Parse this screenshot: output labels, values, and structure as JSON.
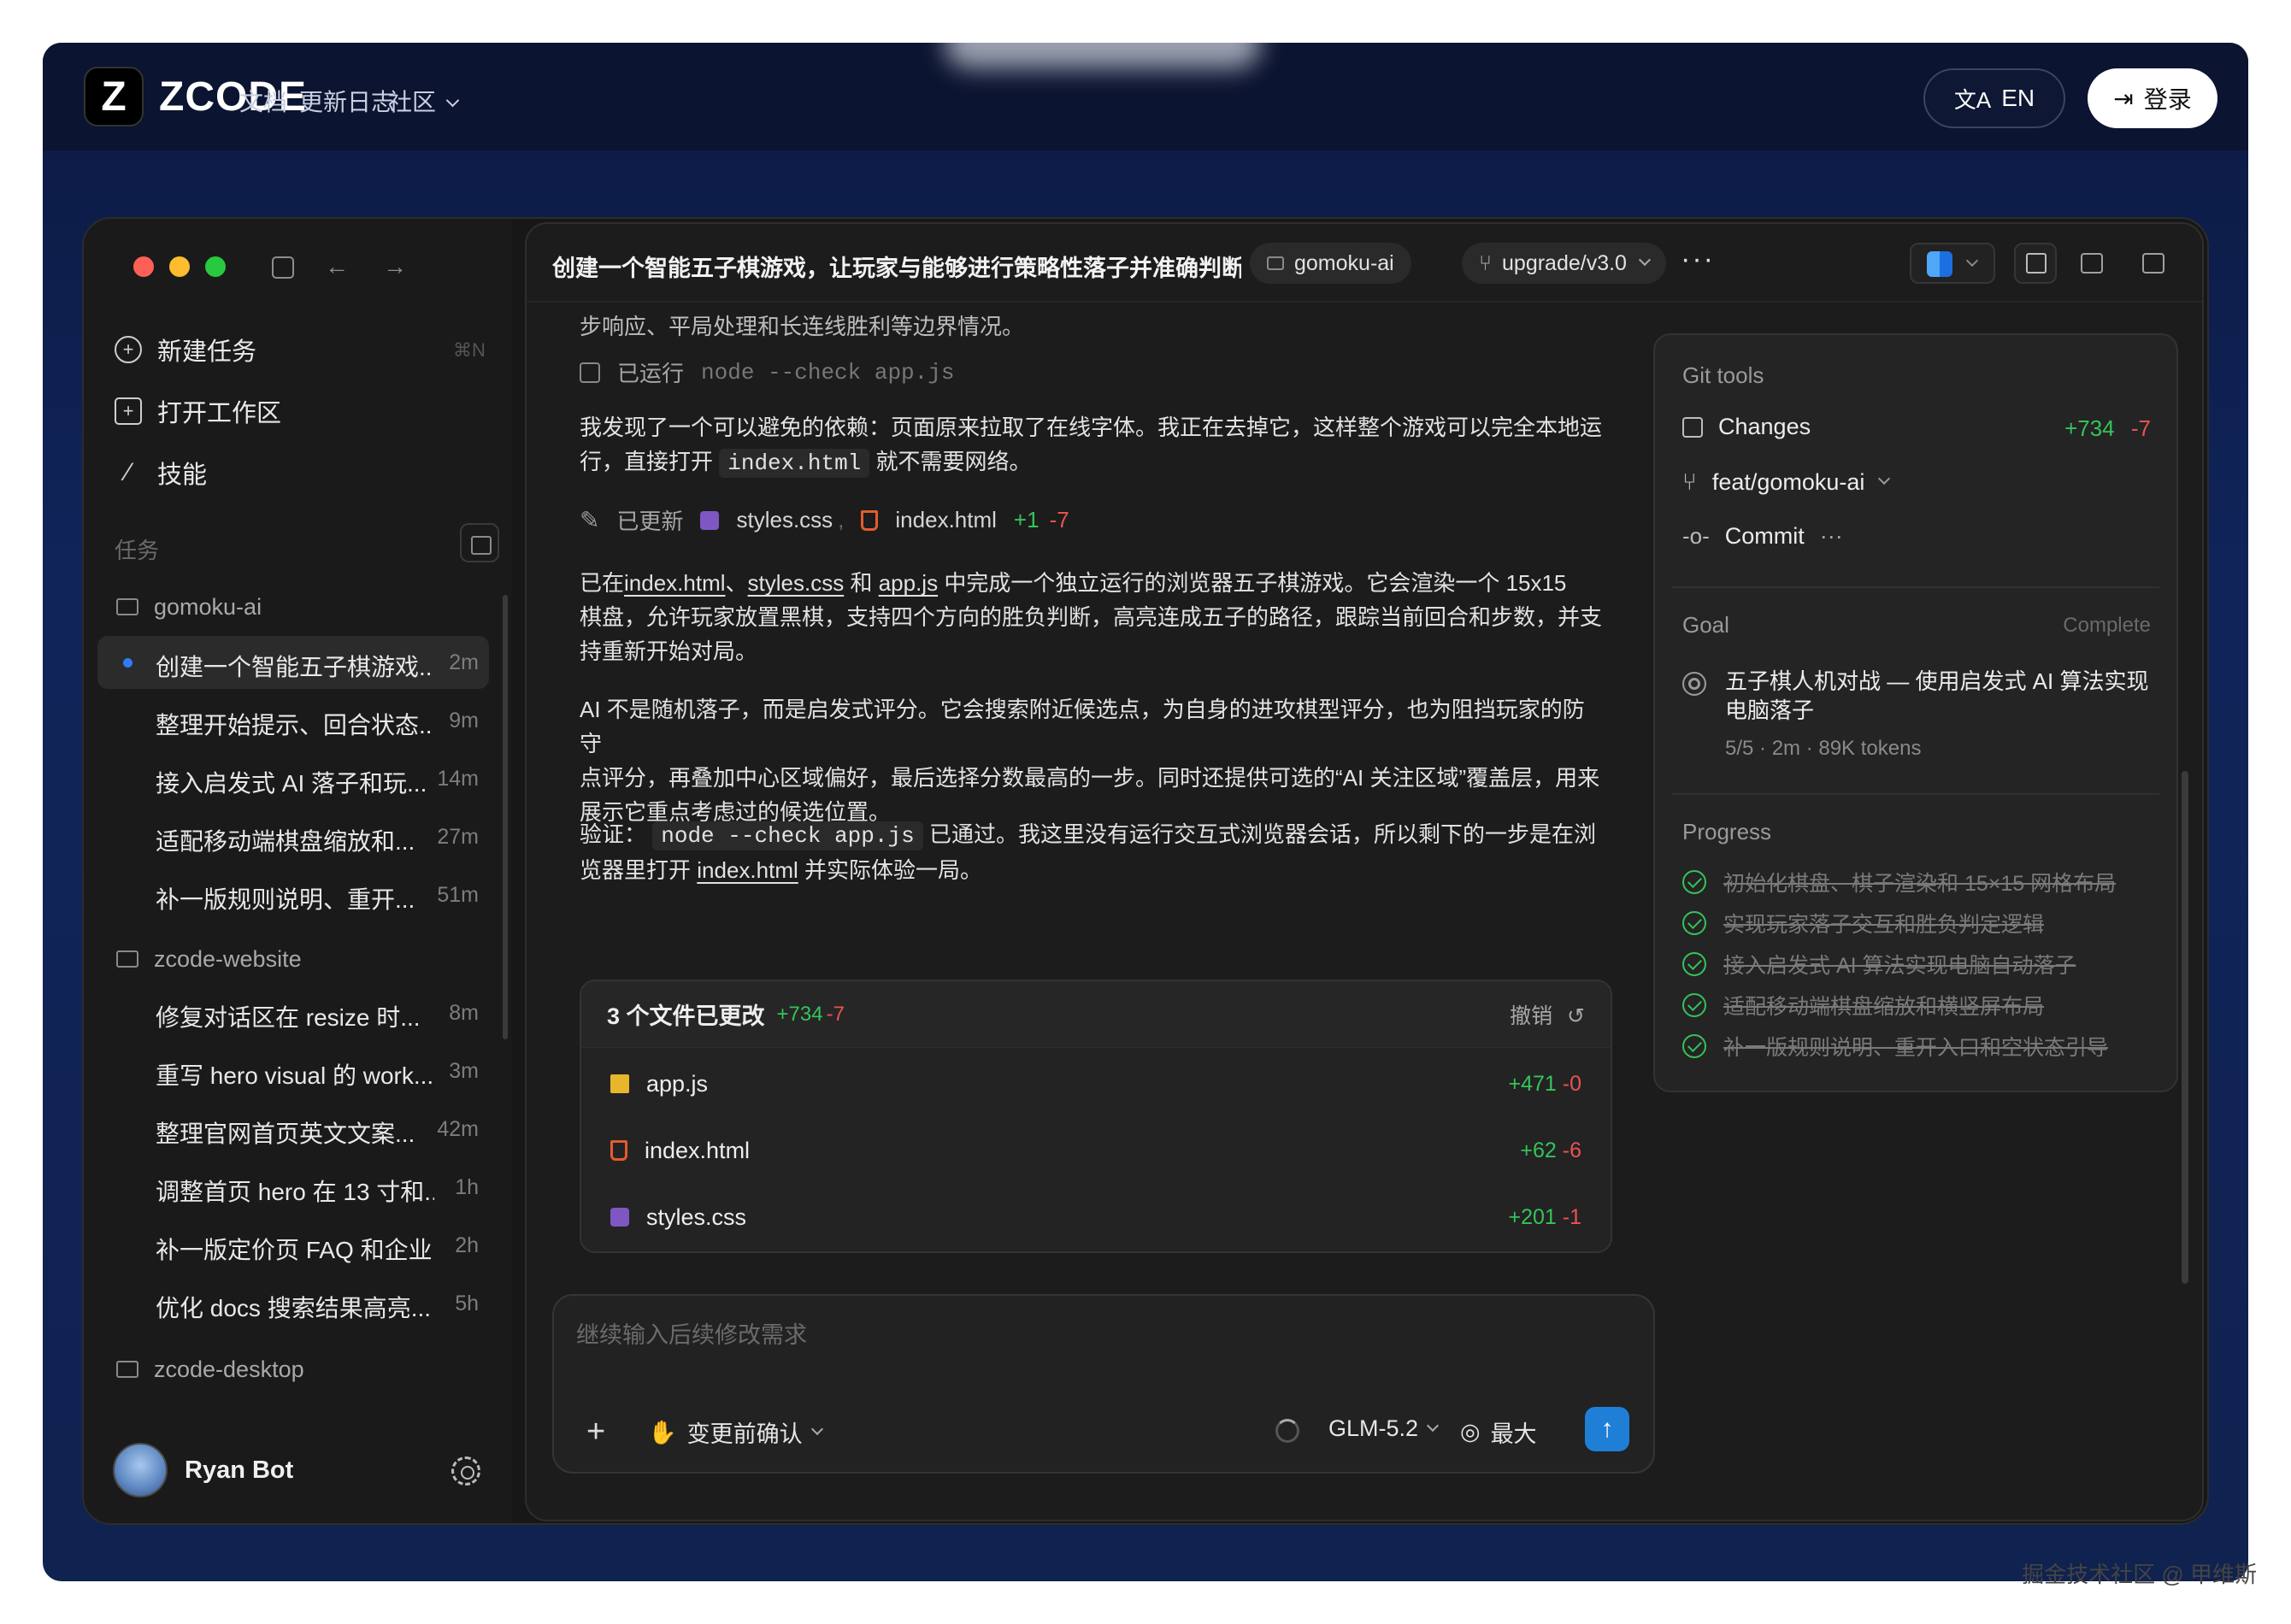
{
  "site": {
    "logo_text": "ZCODE",
    "nav": [
      "文档",
      "更新日志",
      "社区"
    ],
    "lang_label": "EN",
    "login_label": "登录"
  },
  "sidebar": {
    "menu": [
      {
        "label": "新建任务",
        "icon": "plus-circle-icon",
        "shortcut": "⌘N"
      },
      {
        "label": "打开工作区",
        "icon": "folder-open-icon",
        "shortcut": ""
      },
      {
        "label": "技能",
        "icon": "magic-wand-icon",
        "shortcut": ""
      }
    ],
    "section_label": "任务",
    "projects": [
      {
        "name": "gomoku-ai",
        "tasks": [
          {
            "label": "创建一个智能五子棋游戏...",
            "time": "2m",
            "active": true
          },
          {
            "label": "整理开始提示、回合状态...",
            "time": "9m"
          },
          {
            "label": "接入启发式 AI 落子和玩...",
            "time": "14m"
          },
          {
            "label": "适配移动端棋盘缩放和...",
            "time": "27m"
          },
          {
            "label": "补一版规则说明、重开...",
            "time": "51m"
          }
        ]
      },
      {
        "name": "zcode-website",
        "tasks": [
          {
            "label": "修复对话区在 resize 时...",
            "time": "8m"
          },
          {
            "label": "重写 hero visual 的 work...",
            "time": "3m"
          },
          {
            "label": "整理官网首页英文文案...",
            "time": "42m"
          },
          {
            "label": "调整首页 hero 在 13 寸和...",
            "time": "1h"
          },
          {
            "label": "补一版定价页 FAQ 和企业...",
            "time": "2h"
          },
          {
            "label": "优化 docs 搜索结果高亮...",
            "time": "5h"
          }
        ]
      },
      {
        "name": "zcode-desktop",
        "tasks": []
      }
    ],
    "user_name": "Ryan Bot"
  },
  "header": {
    "title": "创建一个智能五子棋游戏，让玩家与能够进行策略性落子并准确判断...",
    "project_pill": "gomoku-ai",
    "branch_pill": "upgrade/v3.0",
    "more": "···"
  },
  "chat": {
    "top_text": "步响应、平局处理和长连线胜利等边界情况。",
    "ran_label": "已运行",
    "ran_cmd": "node --check app.js",
    "p1_a": "我发现了一个可以避免的依赖：页面原来拉取了在线字体。我正在去掉它，这样整个游戏可以完全本地运",
    "p1_b": "行，直接打开",
    "p1_code": "index.html",
    "p1_c": "就不需要网络。",
    "updated_label": "已更新",
    "updated_file1": "styles.css",
    "updated_sep": ",",
    "updated_file2": "index.html",
    "updated_add": "+1",
    "updated_del": "-7",
    "p2_a": "已在",
    "p2_link1": "index.html",
    "p2_sep": "、",
    "p2_link2": "styles.css",
    "p2_and": "和",
    "p2_link3": "app.js",
    "p2_b": "中完成一个独立运行的浏览器五子棋游戏。它会渲染一个 15x15",
    "p2_c": "棋盘，允许玩家放置黑棋，支持四个方向的胜负判断，高亮连成五子的路径，跟踪当前回合和步数，并支",
    "p2_d": "持重新开始对局。",
    "p3_a": "AI 不是随机落子，而是启发式评分。它会搜索附近候选点，为自身的进攻棋型评分，也为阻挡玩家的防守",
    "p3_b": "点评分，再叠加中心区域偏好，最后选择分数最高的一步。同时还提供可选的“AI 关注区域”覆盖层，用来",
    "p3_c": "展示它重点考虑过的候选位置。",
    "p4_a": "验证：",
    "p4_code": "node --check app.js",
    "p4_b": "已通过。我这里没有运行交互式浏览器会话，所以剩下的一步是在浏",
    "p4_c": "览器里打开",
    "p4_link": "index.html",
    "p4_d": "并实际体验一局。"
  },
  "files_card": {
    "title": "3 个文件已更改",
    "add": "+734",
    "del": "-7",
    "undo_label": "撤销",
    "files": [
      {
        "name": "app.js",
        "icon": "js-file-icon",
        "add": "+471",
        "del": "-0"
      },
      {
        "name": "index.html",
        "icon": "html-file-icon",
        "add": "+62",
        "del": "-6"
      },
      {
        "name": "styles.css",
        "icon": "css-file-icon",
        "add": "+201",
        "del": "-1"
      }
    ]
  },
  "composer": {
    "placeholder": "继续输入后续修改需求",
    "confirm_label": "变更前确认",
    "model_label": "GLM-5.2",
    "effort_label": "最大"
  },
  "git_tools": {
    "title": "Git tools",
    "changes_label": "Changes",
    "changes_add": "+734",
    "changes_del": "-7",
    "branch": "feat/gomoku-ai",
    "commit_label": "Commit",
    "commit_more": "···",
    "goal_label": "Goal",
    "goal_status": "Complete",
    "goal_text_1": "五子棋人机对战 — 使用启发式 AI 算法实现",
    "goal_text_2": "电脑落子",
    "goal_meta": "5/5 · 2m · 89K tokens",
    "progress_label": "Progress",
    "progress": [
      "初始化棋盘、棋子渲染和 15×15 网格布局",
      "实现玩家落子交互和胜负判定逻辑",
      "接入启发式 AI 算法实现电脑自动落子",
      "适配移动端棋盘缩放和横竖屏布局",
      "补一版规则说明、重开入口和空状态引导"
    ]
  },
  "watermark": "掘金技术社区 @ 甲维斯",
  "colors": {
    "accent": "#2f7cf6",
    "add": "#35c35a",
    "del": "#ea5252",
    "send": "#1f7fd6"
  }
}
